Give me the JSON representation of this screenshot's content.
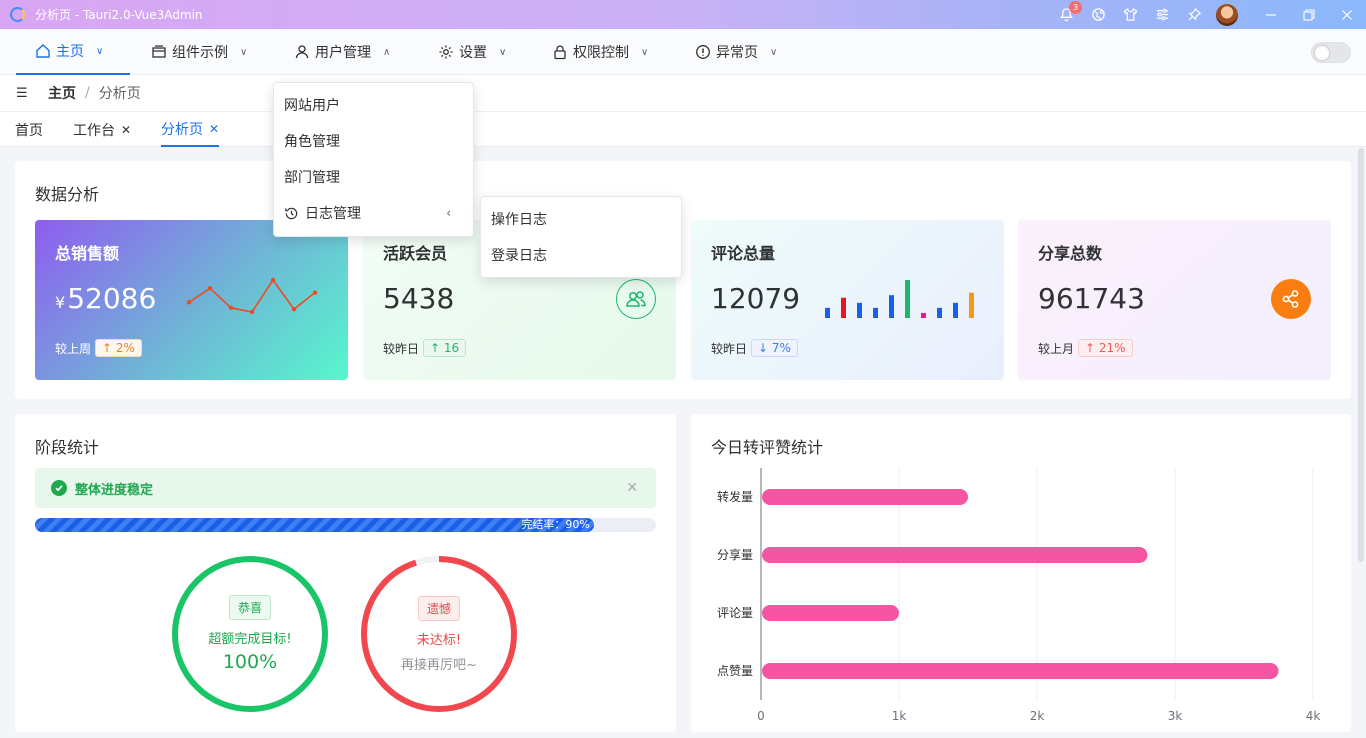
{
  "titlebar": {
    "title": "分析页 - Tauri2.0-Vue3Admin",
    "notification_count": "3",
    "icons": [
      "bell-icon",
      "globe-icon",
      "shirt-icon",
      "sliders-icon",
      "pin-icon"
    ],
    "window_buttons": [
      "minimize-icon",
      "restore-icon",
      "close-icon"
    ]
  },
  "menubar": {
    "items": [
      {
        "label": "主页",
        "icon": "home-icon",
        "chevron": "down"
      },
      {
        "label": "组件示例",
        "icon": "box-icon",
        "chevron": "down"
      },
      {
        "label": "用户管理",
        "icon": "user-icon",
        "chevron": "up"
      },
      {
        "label": "设置",
        "icon": "gear-icon",
        "chevron": "down"
      },
      {
        "label": "权限控制",
        "icon": "lock-icon",
        "chevron": "down"
      },
      {
        "label": "异常页",
        "icon": "alert-icon",
        "chevron": "down"
      }
    ]
  },
  "dropdown": {
    "items": [
      "网站用户",
      "角色管理",
      "部门管理",
      "日志管理"
    ],
    "submenu": [
      "操作日志",
      "登录日志"
    ]
  },
  "breadcrumb": {
    "home": "主页",
    "separator": "/",
    "current": "分析页"
  },
  "tags": [
    {
      "label": "首页",
      "closable": false,
      "active": false
    },
    {
      "label": "工作台",
      "closable": true,
      "active": false
    },
    {
      "label": "分析页",
      "closable": true,
      "active": true
    }
  ],
  "data_analysis": {
    "title": "数据分析",
    "cards": [
      {
        "title": "总销售额",
        "currency": "¥",
        "value": "52086",
        "compare_label": "较上周",
        "trend": "up",
        "change": "2%",
        "sparkline": [
          12,
          22,
          8,
          5,
          28,
          7,
          19
        ]
      },
      {
        "title": "活跃会员",
        "value": "5438",
        "compare_label": "较昨日",
        "trend": "up",
        "change": "16",
        "icon": "users-icon"
      },
      {
        "title": "评论总量",
        "value": "12079",
        "compare_label": "较昨日",
        "trend": "down",
        "change": "7%",
        "mini_bars": [
          {
            "v": 4,
            "c": "#1a5fe8"
          },
          {
            "v": 8,
            "c": "#e8161a"
          },
          {
            "v": 6,
            "c": "#1a5fe8"
          },
          {
            "v": 4,
            "c": "#1a5fe8"
          },
          {
            "v": 9,
            "c": "#1a5fe8"
          },
          {
            "v": 15,
            "c": "#1fb76a"
          },
          {
            "v": 2,
            "c": "#e41994"
          },
          {
            "v": 4,
            "c": "#1a5fe8"
          },
          {
            "v": 6,
            "c": "#1a5fe8"
          },
          {
            "v": 10,
            "c": "#f59a12"
          }
        ]
      },
      {
        "title": "分享总数",
        "value": "961743",
        "compare_label": "较上月",
        "trend": "up",
        "change": "21%",
        "icon": "share-icon"
      }
    ]
  },
  "stage": {
    "title": "阶段统计",
    "alert": "整体进度稳定",
    "progress_label": "完结率：90%",
    "progress": 90,
    "rings": [
      {
        "tag": "恭喜",
        "line1": "超额完成目标!",
        "line2": "100%",
        "color": "#19c566",
        "fill": 1.0
      },
      {
        "tag": "遗憾",
        "line1": "未达标!",
        "line2": "再接再厉吧~",
        "color": "#f1474f",
        "fill": 0.95
      }
    ]
  },
  "chart_data": {
    "type": "bar",
    "orientation": "horizontal",
    "title": "今日转评赞统计",
    "categories": [
      "转发量",
      "分享量",
      "评论量",
      "点赞量"
    ],
    "values": [
      1500,
      2800,
      1000,
      3750
    ],
    "xlim": [
      0,
      4000
    ],
    "xticks": [
      "0",
      "1k",
      "2k",
      "3k",
      "4k"
    ],
    "color": "#f556a4",
    "grid": true
  }
}
